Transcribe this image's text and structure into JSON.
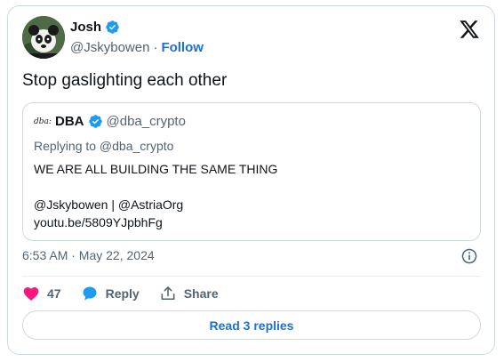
{
  "author": {
    "name": "Josh",
    "handle": "@Jskybowen",
    "separator": "·",
    "follow_label": "Follow"
  },
  "tweet": {
    "text": "Stop gaslighting each other",
    "timestamp": "6:53 AM · May 22, 2024"
  },
  "quote": {
    "avatar_text": "dba:",
    "name": "DBA",
    "handle": "@dba_crypto",
    "replying_to": "Replying to @dba_crypto",
    "lines": [
      "WE ARE ALL BUILDING THE SAME THING",
      "",
      "@Jskybowen | @AstriaOrg",
      "youtu.be/5809YJpbhFg"
    ]
  },
  "actions": {
    "like_count": "47",
    "reply_label": "Reply",
    "share_label": "Share"
  },
  "read_replies_label": "Read 3 replies",
  "colors": {
    "accent": "#1d9bf0",
    "link": "#1d6fd1",
    "like": "#f91880",
    "muted": "#536471",
    "border": "#cfd9de"
  },
  "icons": [
    "verified-badge-icon",
    "x-logo-icon",
    "info-icon",
    "heart-icon",
    "reply-bubble-icon",
    "share-icon"
  ]
}
